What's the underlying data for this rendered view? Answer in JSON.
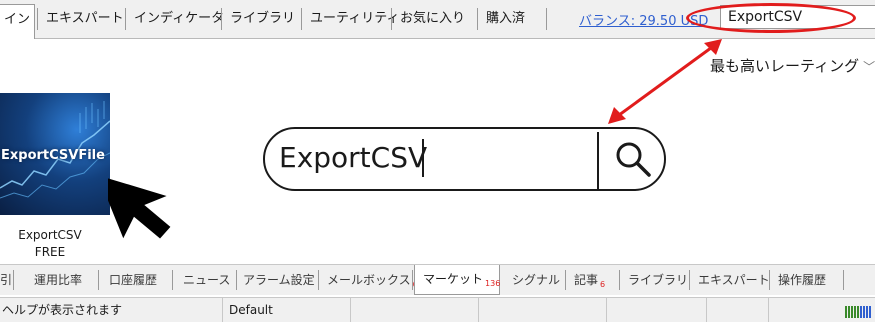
{
  "top_tabs": [
    {
      "label": "イン"
    },
    {
      "label": "エキスパート"
    },
    {
      "label": "インディケータ"
    },
    {
      "label": "ライブラリ"
    },
    {
      "label": "ユーティリティ"
    },
    {
      "label": "お気に入り"
    },
    {
      "label": "購入済"
    }
  ],
  "balance": {
    "label": "バランス: 29.50 USD"
  },
  "top_search": {
    "value": "ExportCSV"
  },
  "sort": {
    "label": "最も高いレーティング"
  },
  "product": {
    "thumb_title": "ExportCSVFile",
    "name": "ExportCSV",
    "price": "FREE"
  },
  "big_search": {
    "value": "ExportCSV"
  },
  "bottom_tabs": [
    {
      "label": "引"
    },
    {
      "label": "運用比率"
    },
    {
      "label": "口座履歴"
    },
    {
      "label": "ニュース"
    },
    {
      "label": "アラーム設定"
    },
    {
      "label": "メールボックス",
      "badge": "6"
    },
    {
      "label": "マーケット",
      "badge": "136"
    },
    {
      "label": "シグナル"
    },
    {
      "label": "記事",
      "badge": "6"
    },
    {
      "label": "ライブラリ"
    },
    {
      "label": "エキスパート"
    },
    {
      "label": "操作履歴"
    }
  ],
  "status": {
    "help": "ヘルプが表示されます",
    "profile": "Default"
  },
  "colors": {
    "annotation_red": "#e11c1c",
    "link_blue": "#2f5fcf",
    "thumb_blue": "#13407d"
  }
}
